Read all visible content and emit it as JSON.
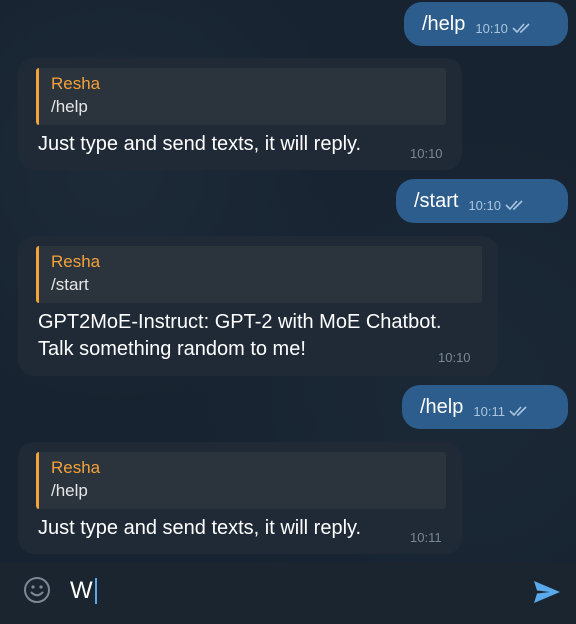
{
  "messages": [
    {
      "type": "outgoing",
      "text": "/help",
      "time": "10:10"
    },
    {
      "type": "incoming",
      "reply_name": "Resha",
      "reply_text": "/help",
      "lines": [
        "Just type and send texts, it will reply."
      ],
      "time": "10:10"
    },
    {
      "type": "outgoing",
      "text": "/start",
      "time": "10:10"
    },
    {
      "type": "incoming",
      "reply_name": "Resha",
      "reply_text": "/start",
      "lines": [
        "GPT2MoE-Instruct: GPT-2 with MoE Chatbot.",
        "Talk something random to me!"
      ],
      "time": "10:10"
    },
    {
      "type": "outgoing",
      "text": "/help",
      "time": "10:11"
    },
    {
      "type": "incoming",
      "reply_name": "Resha",
      "reply_text": "/help",
      "lines": [
        "Just type and send texts, it will reply."
      ],
      "time": "10:11"
    }
  ],
  "composer": {
    "input_value": "W",
    "emoji_icon": "smile-icon",
    "send_icon": "send-arrow-icon"
  },
  "colors": {
    "outgoing_bubble": "#2d5d8c",
    "incoming_bubble": "#1f2a36",
    "reply_accent": "#f4a23a",
    "send_accent": "#5aa9ea"
  }
}
